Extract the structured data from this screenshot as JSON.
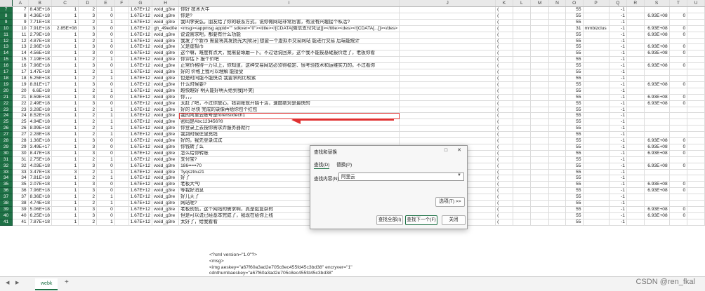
{
  "columns": [
    "",
    "A",
    "B",
    "C",
    "D",
    "E",
    "F",
    "G",
    "H",
    "I",
    "J",
    "K",
    "L",
    "M",
    "N",
    "O",
    "P",
    "Q",
    "R",
    "S",
    "T",
    "U"
  ],
  "rows": [
    {
      "n": "7",
      "A": "7",
      "B": "8.43E+18",
      "C": "1",
      "D": "2",
      "E": "1",
      "G": "1.67E+12",
      "H": "wxid_g3re",
      "I": "你好 技术大牛",
      "K": "(",
      "O": "55",
      "Q": "-1"
    },
    {
      "n": "8",
      "A": "8",
      "B": "4.36E+18",
      "C": "1",
      "D": "3",
      "E": "0",
      "G": "1.67E+12",
      "H": "wxid_g3re",
      "I": "你是?",
      "K": "(",
      "O": "55",
      "Q": "-1",
      "S": "6.93E+08",
      "T": "0"
    },
    {
      "n": "9",
      "A": "9",
      "B": "7.71E+18",
      "C": "1",
      "D": "2",
      "E": "1",
      "G": "1.67E+12",
      "H": "wxid_g3re",
      "I": "我叫李安弘，朋友给了你的联系方式，说你做网站非常厉害，有没有兴趣接个私活?",
      "K": "(",
      "O": "55",
      "Q": "-1"
    },
    {
      "n": "10",
      "A": "10",
      "B": "7.91E+18",
      "C": "2.85E+08",
      "D": "3",
      "E": "0",
      "G": "1.67E+12",
      "H": "gh_49ed0e",
      "I": "<msg><appmsg appid=\"\" sdkver=\"0\"><title><![CDATA[微信支付凭证]]></title><des><![CDATA[...]]></des>",
      "K": "(",
      "O": "31",
      "P": "mmbizclus",
      "Q": "-1",
      "S": "6.93E+08",
      "T": "0"
    },
    {
      "n": "11",
      "A": "11",
      "B": "2.79E+18",
      "C": "1",
      "D": "3",
      "E": "0",
      "G": "1.67E+12",
      "H": "wxid_g3re",
      "I": "说说需求吧，都要有什么功能",
      "K": "(",
      "O": "55",
      "Q": "-1",
      "S": "6.93E+08",
      "T": "0"
    },
    {
      "n": "12",
      "A": "12",
      "B": "4.87E+18",
      "C": "1",
      "D": "2",
      "E": "1",
      "G": "1.67E+12",
      "H": "wxid_g3re",
      "I": "我发了个新币 需要将其发扬光大[呲牙] 想要一个虚拟币交易网站 能进行交易 后端能统计",
      "K": "(",
      "O": "55",
      "Q": "-1"
    },
    {
      "n": "13",
      "A": "13",
      "B": "2.96E+18",
      "C": "1",
      "D": "3",
      "E": "0",
      "G": "1.67E+12",
      "H": "wxid_g3re",
      "I": "又是虚拟币",
      "K": "(",
      "O": "55",
      "Q": "-1",
      "S": "6.93E+08",
      "T": "0"
    },
    {
      "n": "14",
      "A": "14",
      "B": "4.56E+18",
      "C": "1",
      "D": "3",
      "E": "0",
      "G": "1.67E+12",
      "H": "wxid_g3re",
      "I": "这个嘛，难度有点大，我需要琢磨一下。不过话说回来，这个我不能按基础报价走了，老板你看",
      "K": "(",
      "O": "55",
      "Q": "-1",
      "S": "6.93E+08",
      "T": "0"
    },
    {
      "n": "15",
      "A": "15",
      "B": "7.19E+18",
      "C": "1",
      "D": "2",
      "E": "1",
      "G": "1.67E+12",
      "H": "wxid_g3re",
      "I": "你评估下 报个价吧",
      "K": "(",
      "O": "55",
      "Q": "-1"
    },
    {
      "n": "16",
      "A": "16",
      "B": "7.96E+18",
      "C": "1",
      "D": "3",
      "E": "0",
      "G": "1.67E+12",
      "H": "wxid_g3re",
      "I": "正常价格得一万以上，你知道，这种交易网站必须得稳定、很考验技术和运维实力的。不过看你",
      "K": "(",
      "O": "55",
      "Q": "-1",
      "S": "6.93E+08",
      "T": "0"
    },
    {
      "n": "17",
      "A": "17",
      "B": "1.47E+18",
      "C": "1",
      "D": "2",
      "E": "1",
      "G": "1.67E+12",
      "H": "wxid_g3re",
      "I": "好的 价格上我可以理解 能接受",
      "K": "(",
      "O": "55",
      "Q": "-1"
    },
    {
      "n": "18",
      "A": "18",
      "B": "5.25E+18",
      "C": "1",
      "D": "2",
      "E": "1",
      "G": "1.67E+12",
      "H": "wxid_g3re",
      "I": "但是时间能不能快点 我要求的比较紧",
      "K": "(",
      "O": "55",
      "Q": "-1"
    },
    {
      "n": "19",
      "A": "19",
      "B": "8.81E+17",
      "C": "1",
      "D": "3",
      "E": "0",
      "G": "1.67E+12",
      "H": "wxid_g3re",
      "I": "什么时候要?",
      "K": "(",
      "O": "55",
      "Q": "-1",
      "S": "6.93E+08",
      "T": "0"
    },
    {
      "n": "20",
      "A": "20",
      "B": "6.6E+18",
      "C": "1",
      "D": "2",
      "E": "1",
      "G": "1.67E+12",
      "H": "wxid_g3re",
      "I": "越快越好 明天能好明天给到我[坏笑]",
      "K": "(",
      "O": "55",
      "Q": "-1"
    },
    {
      "n": "21",
      "A": "21",
      "B": "8.59E+18",
      "C": "1",
      "D": "3",
      "E": "0",
      "G": "1.67E+12",
      "H": "wxid_g3re",
      "I": "你，，，",
      "K": "(",
      "O": "55",
      "Q": "-1",
      "S": "6.93E+08",
      "T": "0"
    },
    {
      "n": "22",
      "A": "22",
      "B": "2.49E+18",
      "C": "1",
      "D": "3",
      "E": "0",
      "G": "1.67E+12",
      "H": "wxid_g3re",
      "I": "太赶了吧，不过你放心，钱到账就开始干活，速度绝对是最快的",
      "K": "(",
      "O": "55",
      "Q": "-1",
      "S": "6.93E+08",
      "T": "0"
    },
    {
      "n": "23",
      "A": "23",
      "B": "3.28E+18",
      "C": "1",
      "D": "2",
      "E": "1",
      "G": "1.67E+12",
      "H": "wxid_g3re",
      "I": "好的 尽快 完成的录像再给你包个红包",
      "K": "(",
      "O": "55",
      "Q": "-1"
    },
    {
      "n": "24",
      "A": "24",
      "B": "8.52E+18",
      "C": "1",
      "D": "2",
      "E": "1",
      "G": "1.67E+12",
      "H": "wxid_g3re",
      "I": "我的阿里云账号是forensixtech1",
      "K": "(",
      "O": "55",
      "Q": "-1",
      "hl": true
    },
    {
      "n": "25",
      "A": "25",
      "B": "4.94E+18",
      "C": "1",
      "D": "2",
      "E": "1",
      "G": "1.67E+12",
      "H": "wxid_g3re",
      "I": "密码是Abc123456?8",
      "K": "(",
      "O": "55",
      "Q": "-1"
    },
    {
      "n": "26",
      "A": "26",
      "B": "8.99E+18",
      "C": "1",
      "D": "2",
      "E": "1",
      "G": "1.67E+12",
      "H": "wxid_g3re",
      "I": "你登录上去按你需求弄服务器就行",
      "K": "(",
      "O": "55",
      "Q": "-1"
    },
    {
      "n": "27",
      "A": "27",
      "B": "2.28E+18",
      "C": "1",
      "D": "2",
      "E": "1",
      "G": "1.67E+12",
      "H": "wxid_g3re",
      "I": "我到时候往里充钱",
      "K": "(",
      "O": "55",
      "Q": "-1"
    },
    {
      "n": "28",
      "A": "28",
      "B": "1.36E+18",
      "C": "1",
      "D": "3",
      "E": "0",
      "G": "1.67E+12",
      "H": "wxid_g3re",
      "I": "好的，我先登录试试",
      "K": "(",
      "O": "55",
      "Q": "-1",
      "S": "6.93E+08",
      "T": "0"
    },
    {
      "n": "29",
      "A": "29",
      "B": "3.49E+17",
      "C": "1",
      "D": "3",
      "E": "0",
      "G": "1.67E+12",
      "H": "wxid_g3re",
      "I": "你钱转了么",
      "K": "(",
      "O": "55",
      "Q": "-1",
      "S": "6.93E+08",
      "T": "0"
    },
    {
      "n": "30",
      "A": "30",
      "B": "8.47E+18",
      "C": "1",
      "D": "3",
      "E": "0",
      "G": "1.67E+12",
      "H": "wxid_g3re",
      "I": "怎么给你转账",
      "K": "(",
      "O": "55",
      "Q": "-1",
      "S": "6.93E+08",
      "T": "0"
    },
    {
      "n": "31",
      "A": "31",
      "B": "2.75E+18",
      "C": "1",
      "D": "2",
      "E": "1",
      "G": "1.67E+12",
      "H": "wxid_g3re",
      "I": "支付宝?",
      "K": "(",
      "O": "55",
      "Q": "-1"
    },
    {
      "n": "32",
      "A": "32",
      "B": "4.03E+18",
      "C": "1",
      "D": "3",
      "E": "0",
      "G": "1.67E+12",
      "H": "wxid_g3re",
      "I": "186•••••70",
      "K": "(",
      "O": "55",
      "Q": "-1",
      "S": "6.93E+08",
      "T": "0"
    },
    {
      "n": "33",
      "A": "33",
      "B": "3.47E+18",
      "C": "3",
      "D": "2",
      "E": "1",
      "G": "1.67E+12",
      "H": "wxid_g3re",
      "I": "Tyqsztnu21",
      "K": "(",
      "O": "55",
      "Q": "-1"
    },
    {
      "n": "34",
      "A": "34",
      "B": "7.81E+18",
      "C": "1",
      "D": "2",
      "E": "1",
      "G": "1.67E+12",
      "H": "wxid_g3re",
      "I": "好了",
      "K": "(",
      "O": "55",
      "Q": "-1"
    },
    {
      "n": "35",
      "A": "35",
      "B": "2.07E+18",
      "C": "1",
      "D": "3",
      "E": "0",
      "G": "1.67E+12",
      "H": "wxid_g3re",
      "I": "老板大气!",
      "K": "(",
      "O": "55",
      "Q": "-1",
      "S": "6.93E+08",
      "T": "0"
    },
    {
      "n": "36",
      "A": "36",
      "B": "7.96E+18",
      "C": "1",
      "D": "3",
      "E": "0",
      "G": "1.67E+12",
      "H": "wxid_g3re",
      "I": "等我好消息",
      "K": "(",
      "O": "55",
      "Q": "-1",
      "S": "6.93E+08",
      "T": "0"
    },
    {
      "n": "37",
      "A": "37",
      "B": "8.36E+18",
      "C": "1",
      "D": "2",
      "E": "1",
      "G": "1.67E+12",
      "H": "wxid_g3re",
      "I": "好几天了",
      "K": "(",
      "O": "55",
      "Q": "-1"
    },
    {
      "n": "38",
      "A": "38",
      "B": "4.74E+18",
      "C": "1",
      "D": "2",
      "E": "1",
      "G": "1.67E+12",
      "H": "wxid_g3re",
      "I": "网站呢?",
      "K": "(",
      "O": "55",
      "Q": "-1"
    },
    {
      "n": "39",
      "A": "39",
      "B": "5.06E+18",
      "C": "1",
      "D": "3",
      "E": "0",
      "G": "1.67E+12",
      "H": "wxid_g3re",
      "I": "老板别慌，这个网站的需求啊，真是挺复杂的",
      "K": "(",
      "O": "55",
      "Q": "-1",
      "S": "6.93E+08",
      "T": "0"
    },
    {
      "n": "40",
      "A": "40",
      "B": "6.25E+18",
      "C": "1",
      "D": "3",
      "E": "0",
      "G": "1.67E+12",
      "H": "wxid_g3re",
      "I": "但是可以说已经基本完成了，我现在给你上线",
      "K": "(",
      "O": "55",
      "Q": "-1",
      "S": "6.93E+08",
      "T": "0"
    },
    {
      "n": "41",
      "A": "41",
      "B": "7.87E+18",
      "C": "1",
      "D": "2",
      "E": "1",
      "G": "1.67E+12",
      "H": "wxid_g3re",
      "I": "太好了，给我看看",
      "K": "(",
      "O": "55",
      "Q": "-1"
    }
  ],
  "xml_overflow": [
    "<?xml version=\"1.0\"?>",
    "<msg>",
    "<img aeskey=\"a67f60a3ad2e705c8ec455fd45c3bd38\" encryver=\"1\"",
    "cdnthumbaeskey=\"a67f60a3ad2e705c8ec455fd45c3bd38\""
  ],
  "dialog": {
    "title": "查找和替换",
    "minimize_icon": "□",
    "close_icon": "✕",
    "tab_find": "查找(D)",
    "tab_replace": "替换(P)",
    "find_label": "查找内容(N):",
    "find_value": "阿里云",
    "options_button": "选项(T) >>",
    "find_all_button": "查找全部(I)",
    "find_next_button": "查找下一个(F)",
    "close_button": "关闭"
  },
  "sheet_tab": "webk",
  "watermark": "CSDN @ren_fkal",
  "colors": {
    "accent": "#1e7145",
    "highlight": "#e03030"
  }
}
